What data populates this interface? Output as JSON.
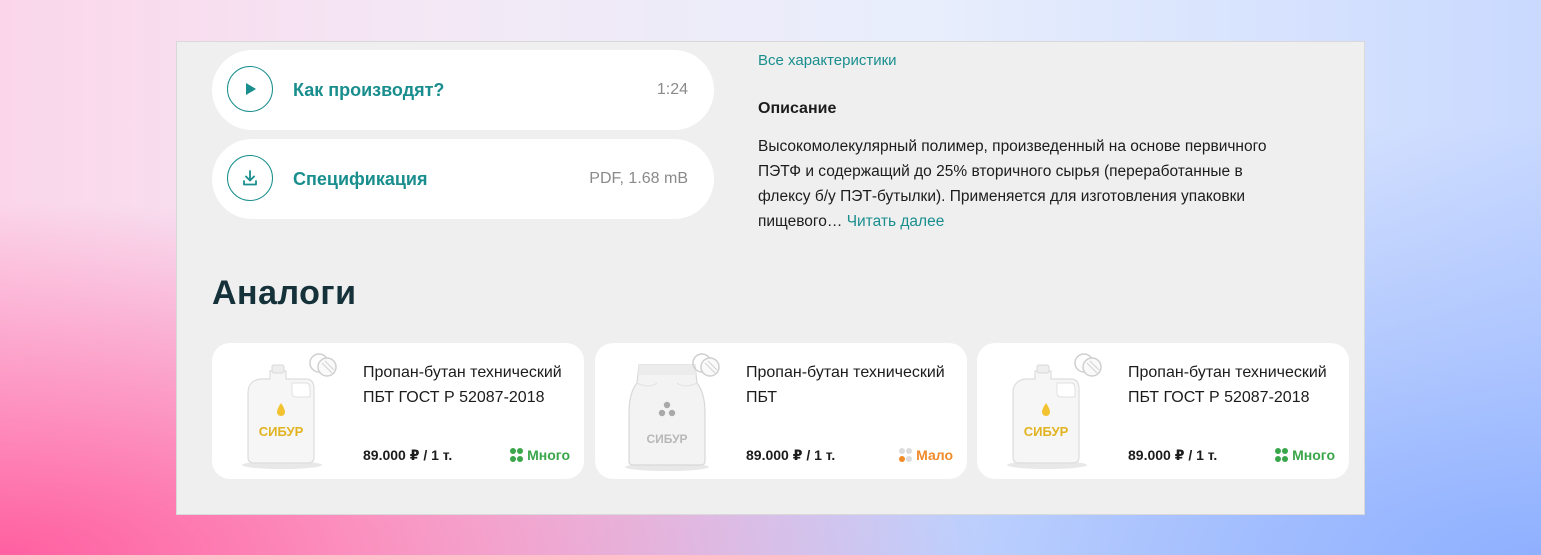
{
  "colors": {
    "accent": "#1a8e8e",
    "stock_many": "#3aa64a",
    "stock_few": "#f08a2a",
    "stock_inactive": "#dcdcdc",
    "panel_bg": "#efefef",
    "card_bg": "#ffffff"
  },
  "media": [
    {
      "icon": "play-icon",
      "title": "Как производят?",
      "meta": "1:24"
    },
    {
      "icon": "download-icon",
      "title": "Спецификация",
      "meta": "PDF, 1.68 mB"
    }
  ],
  "specs": {
    "all_link": "Все характеристики",
    "description_title": "Описание",
    "description_text": "Высокомолекулярный полимер, произведенный на основе первичного ПЭТФ и содержащий до 25% вторичного сырья (переработанные в флексу б/у ПЭТ-бутылки). Применяется для изготовления упаковки пищевого…",
    "read_more": "Читать далее"
  },
  "analogs": {
    "title": "Аналоги",
    "products": [
      {
        "name": "Пропан-бутан технический ПБТ ГОСТ Р 52087-2018",
        "price": "89.000 ₽ / 1 т.",
        "stock": "Много",
        "stock_level": 4,
        "image": "canister-icon",
        "brand": "СИБУР"
      },
      {
        "name": "Пропан-бутан технический ПБТ",
        "price": "89.000 ₽ / 1 т.",
        "stock": "Мало",
        "stock_level": 1,
        "image": "bag-icon",
        "brand": "СИБУР"
      },
      {
        "name": "Пропан-бутан технический ПБТ ГОСТ Р 52087-2018",
        "price": "89.000 ₽ / 1 т.",
        "stock": "Много",
        "stock_level": 4,
        "image": "canister-icon",
        "brand": "СИБУР"
      }
    ]
  }
}
